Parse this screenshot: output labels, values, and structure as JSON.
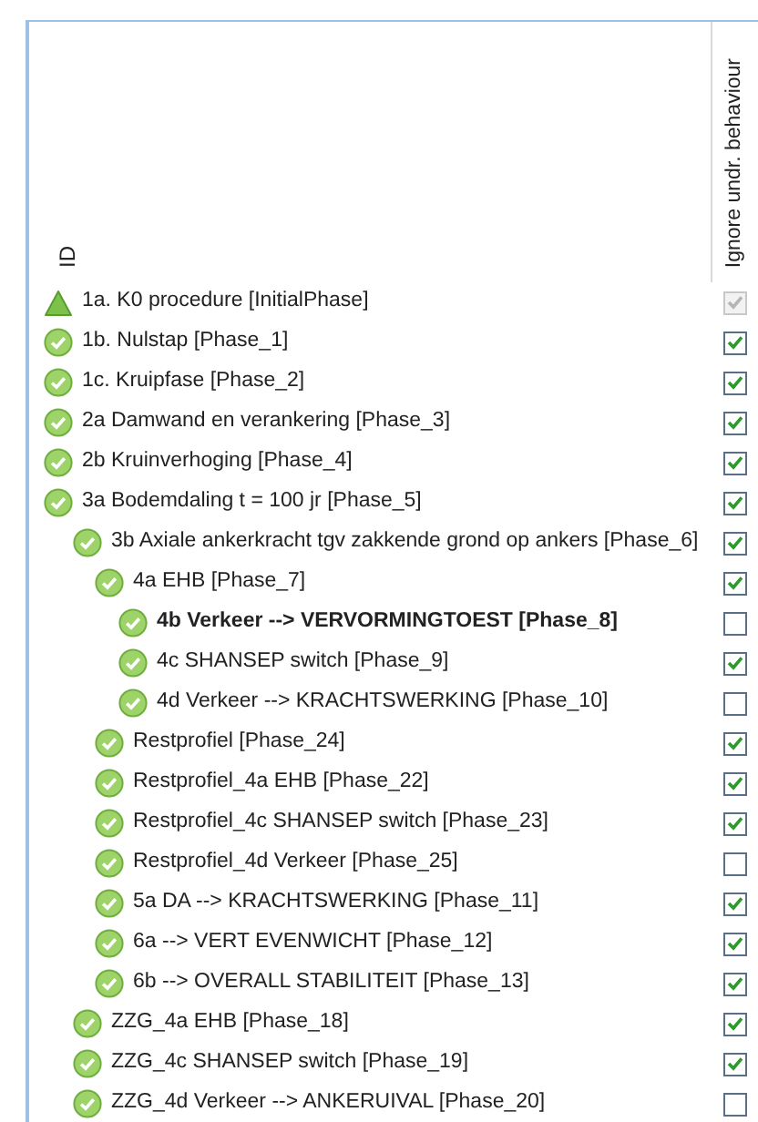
{
  "columns": {
    "id": "ID",
    "ignore": "Ignore undr. behaviour"
  },
  "phases": [
    {
      "kind": "initial",
      "label": "1a. K0 procedure [InitialPhase]",
      "current": false,
      "checked": true,
      "disabled": true
    },
    {
      "kind": "phase",
      "label": "1b. Nulstap [Phase_1]",
      "current": false,
      "checked": true,
      "disabled": false
    },
    {
      "kind": "phase",
      "label": "1c. Kruipfase [Phase_2]",
      "current": false,
      "checked": true,
      "disabled": false
    },
    {
      "kind": "phase",
      "label": "2a Damwand en verankering [Phase_3]",
      "current": false,
      "checked": true,
      "disabled": false
    },
    {
      "kind": "phase",
      "label": "2b Kruinverhoging [Phase_4]",
      "current": false,
      "checked": true,
      "disabled": false
    },
    {
      "kind": "phase",
      "label": "3a Bodemdaling t = 100 jr [Phase_5]",
      "current": false,
      "checked": true,
      "disabled": false,
      "children": [
        {
          "kind": "phase",
          "label": "3b Axiale ankerkracht tgv zakkende grond op ankers [Phase_6]",
          "current": false,
          "checked": true,
          "disabled": false,
          "children": [
            {
              "kind": "phase",
              "label": "4a EHB [Phase_7]",
              "current": false,
              "checked": true,
              "disabled": false,
              "children": [
                {
                  "kind": "phase",
                  "label": "4b Verkeer --> VERVORMINGTOEST [Phase_8]",
                  "current": true,
                  "checked": false,
                  "disabled": false
                },
                {
                  "kind": "phase",
                  "label": "4c SHANSEP switch [Phase_9]",
                  "current": false,
                  "checked": true,
                  "disabled": false
                },
                {
                  "kind": "phase",
                  "label": "4d Verkeer --> KRACHTSWERKING [Phase_10]",
                  "current": false,
                  "checked": false,
                  "disabled": false
                }
              ]
            },
            {
              "kind": "phase",
              "label": "Restprofiel [Phase_24]",
              "current": false,
              "checked": true,
              "disabled": false
            },
            {
              "kind": "phase",
              "label": "Restprofiel_4a EHB [Phase_22]",
              "current": false,
              "checked": true,
              "disabled": false
            },
            {
              "kind": "phase",
              "label": "Restprofiel_4c SHANSEP switch [Phase_23]",
              "current": false,
              "checked": true,
              "disabled": false
            },
            {
              "kind": "phase",
              "label": "Restprofiel_4d Verkeer [Phase_25]",
              "current": false,
              "checked": false,
              "disabled": false
            },
            {
              "kind": "phase",
              "label": "5a DA --> KRACHTSWERKING [Phase_11]",
              "current": false,
              "checked": true,
              "disabled": false
            },
            {
              "kind": "phase",
              "label": "6a --> VERT EVENWICHT [Phase_12]",
              "current": false,
              "checked": true,
              "disabled": false
            },
            {
              "kind": "phase",
              "label": "6b --> OVERALL STABILITEIT [Phase_13]",
              "current": false,
              "checked": true,
              "disabled": false
            }
          ]
        },
        {
          "kind": "phase",
          "label": "ZZG_4a EHB [Phase_18]",
          "current": false,
          "checked": true,
          "disabled": false
        },
        {
          "kind": "phase",
          "label": "ZZG_4c SHANSEP switch [Phase_19]",
          "current": false,
          "checked": true,
          "disabled": false
        },
        {
          "kind": "phase",
          "label": "ZZG_4d Verkeer --> ANKERUIVAL [Phase_20]",
          "current": false,
          "checked": false,
          "disabled": false
        }
      ]
    }
  ]
}
